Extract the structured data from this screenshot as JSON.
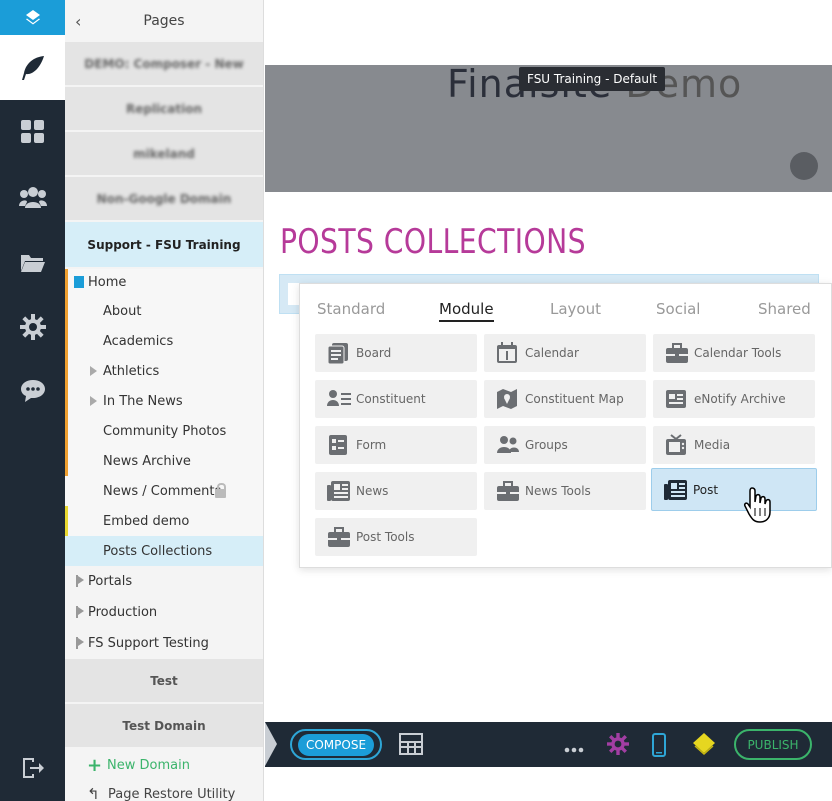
{
  "rail": {
    "items": [
      "layers-icon",
      "feather-icon",
      "grid-modules-icon",
      "users-icon",
      "folder-icon",
      "gear-icon",
      "chat-icon",
      "logout-icon"
    ]
  },
  "pages_panel": {
    "title": "Pages",
    "back_icon": "chevron-left-icon",
    "domains_top": [
      {
        "label": "DEMO: Composer - New",
        "blurred": true
      },
      {
        "label": "Replication",
        "blurred": true
      },
      {
        "label": "mikeland",
        "blurred": true
      },
      {
        "label": "Non-Google Domain",
        "blurred": true
      },
      {
        "label": "Support - FSU Training",
        "active": true
      }
    ],
    "tree": [
      {
        "label": "Home",
        "level": 0
      },
      {
        "label": "About",
        "level": 1
      },
      {
        "label": "Academics",
        "level": 1
      },
      {
        "label": "Athletics",
        "level": 1,
        "expandable": true
      },
      {
        "label": "In The News",
        "level": 1,
        "expandable": true
      },
      {
        "label": "Community Photos",
        "level": 1
      },
      {
        "label": "News Archive",
        "level": 1
      },
      {
        "label": "News / Comments",
        "level": 1,
        "locked": true
      },
      {
        "label": "Embed demo",
        "level": 1
      },
      {
        "label": "Posts Collections",
        "level": 1,
        "selected": true
      }
    ],
    "other_domains": [
      "Portals",
      "Production",
      "FS Support Testing"
    ],
    "domains_bottom": [
      "Test",
      "Test Domain"
    ],
    "new_domain": "New Domain",
    "page_restore": "Page Restore Utility"
  },
  "page": {
    "site_title": "Finalsite",
    "site_title_suffix": "Demo",
    "tooltip": "FSU Training - Default",
    "heading": "POSTS COLLECTIONS"
  },
  "module_picker": {
    "tabs": [
      "Standard",
      "Module",
      "Layout",
      "Social",
      "Shared"
    ],
    "active_tab": "Module",
    "tiles": [
      {
        "label": "Board",
        "icon": "board-icon"
      },
      {
        "label": "Calendar",
        "icon": "calendar-icon"
      },
      {
        "label": "Calendar Tools",
        "icon": "toolbox-icon"
      },
      {
        "label": "Constituent",
        "icon": "constituent-icon"
      },
      {
        "label": "Constituent Map",
        "icon": "map-pin-icon"
      },
      {
        "label": "eNotify Archive",
        "icon": "enotify-icon"
      },
      {
        "label": "Form",
        "icon": "form-icon"
      },
      {
        "label": "Groups",
        "icon": "groups-icon"
      },
      {
        "label": "Media",
        "icon": "tv-icon"
      },
      {
        "label": "News",
        "icon": "newspaper-icon"
      },
      {
        "label": "News Tools",
        "icon": "toolbox-icon"
      },
      {
        "label": "Post",
        "icon": "newspaper-icon",
        "hover": true
      },
      {
        "label": "Post Tools",
        "icon": "toolbox-icon"
      }
    ]
  },
  "toolbar": {
    "compose": "COMPOSE",
    "publish": "PUBLISH",
    "icons": [
      "layout-icon",
      "more-icon",
      "settings-gear-icon",
      "mobile-icon",
      "layers-diamond-icon"
    ]
  },
  "colors": {
    "rail_bg": "#1f2a36",
    "accent_blue": "#1b9dd8",
    "heading_magenta": "#b63a99",
    "publish_green": "#3bb46b",
    "selected_bg": "#d6eef8"
  }
}
